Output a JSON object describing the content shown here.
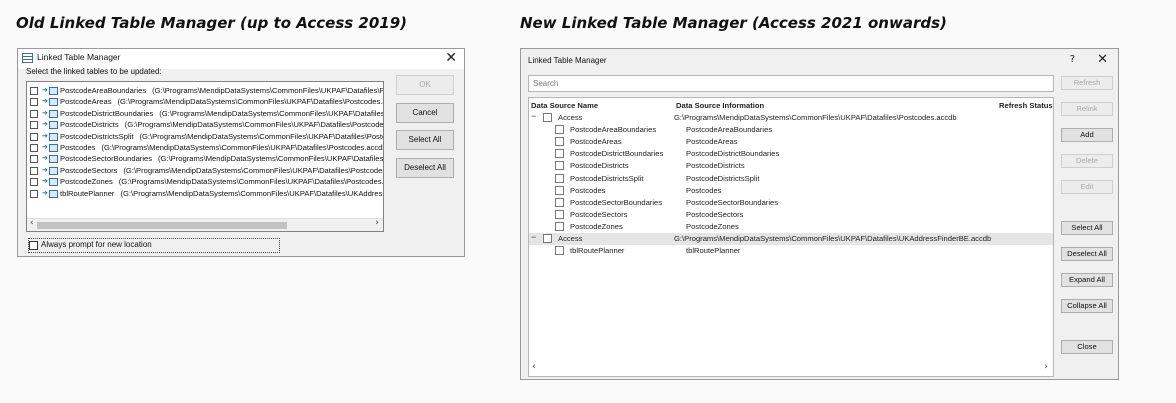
{
  "headings": {
    "old": "Old Linked Table Manager (up to Access 2019)",
    "new": "New Linked Table Manager (Access 2021 onwards)"
  },
  "old_dialog": {
    "title": "Linked Table Manager",
    "close_glyph": "✕",
    "prompt": "Select the linked tables to be updated:",
    "rows": [
      {
        "name": "PostcodeAreaBoundaries",
        "path": "(G:\\Programs\\MendipDataSystems\\CommonFiles\\UKPAF\\Datafiles\\Postcodes.accdb)"
      },
      {
        "name": "PostcodeAreas",
        "path": "(G:\\Programs\\MendipDataSystems\\CommonFiles\\UKPAF\\Datafiles\\Postcodes.accdb)"
      },
      {
        "name": "PostcodeDistrictBoundaries",
        "path": "(G:\\Programs\\MendipDataSystems\\CommonFiles\\UKPAF\\Datafiles\\Postcodes.accdb)"
      },
      {
        "name": "PostcodeDistricts",
        "path": "(G:\\Programs\\MendipDataSystems\\CommonFiles\\UKPAF\\Datafiles\\Postcodes.accdb)"
      },
      {
        "name": "PostcodeDistrictsSplit",
        "path": "(G:\\Programs\\MendipDataSystems\\CommonFiles\\UKPAF\\Datafiles\\Postcodes.accdb)"
      },
      {
        "name": "Postcodes",
        "path": "(G:\\Programs\\MendipDataSystems\\CommonFiles\\UKPAF\\Datafiles\\Postcodes.accdb)"
      },
      {
        "name": "PostcodeSectorBoundaries",
        "path": "(G:\\Programs\\MendipDataSystems\\CommonFiles\\UKPAF\\Datafiles\\Postcodes.accdb)"
      },
      {
        "name": "PostcodeSectors",
        "path": "(G:\\Programs\\MendipDataSystems\\CommonFiles\\UKPAF\\Datafiles\\Postcodes.accdb)"
      },
      {
        "name": "PostcodeZones",
        "path": "(G:\\Programs\\MendipDataSystems\\CommonFiles\\UKPAF\\Datafiles\\Postcodes.accdb)"
      },
      {
        "name": "tblRoutePlanner",
        "path": "(G:\\Programs\\MendipDataSystems\\CommonFiles\\UKPAF\\Datafiles\\UKAddressFinderBE.accdb)"
      }
    ],
    "buttons": {
      "ok": "OK",
      "cancel": "Cancel",
      "select_all": "Select All",
      "deselect_all": "Deselect All"
    },
    "always_prompt": "Always prompt for new location",
    "scroll_left": "‹",
    "scroll_right": "›"
  },
  "new_dialog": {
    "title": "Linked Table Manager",
    "help_glyph": "?",
    "close_glyph": "✕",
    "search_placeholder": "Search",
    "columns": {
      "source_name": "Data Source Name",
      "source_info": "Data Source Information",
      "refresh_status": "Refresh Status"
    },
    "groups": [
      {
        "name": "Access",
        "info": "G:\\Programs\\MendipDataSystems\\CommonFiles\\UKPAF\\Datafiles\\Postcodes.accdb",
        "items": [
          {
            "name": "PostcodeAreaBoundaries",
            "info": "PostcodeAreaBoundaries"
          },
          {
            "name": "PostcodeAreas",
            "info": "PostcodeAreas"
          },
          {
            "name": "PostcodeDistrictBoundaries",
            "info": "PostcodeDistrictBoundaries"
          },
          {
            "name": "PostcodeDistricts",
            "info": "PostcodeDistricts"
          },
          {
            "name": "PostcodeDistrictsSplit",
            "info": "PostcodeDistrictsSplit"
          },
          {
            "name": "Postcodes",
            "info": "Postcodes"
          },
          {
            "name": "PostcodeSectorBoundaries",
            "info": "PostcodeSectorBoundaries"
          },
          {
            "name": "PostcodeSectors",
            "info": "PostcodeSectors"
          },
          {
            "name": "PostcodeZones",
            "info": "PostcodeZones"
          }
        ]
      },
      {
        "name": "Access",
        "info": "G:\\Programs\\MendipDataSystems\\CommonFiles\\UKPAF\\Datafiles\\UKAddressFinderBE.accdb",
        "items": [
          {
            "name": "tblRoutePlanner",
            "info": "tblRoutePlanner"
          }
        ]
      }
    ],
    "buttons": {
      "refresh": "Refresh",
      "relink": "Relink",
      "add": "Add",
      "delete": "Delete",
      "edit": "Edit",
      "select_all": "Select All",
      "deselect_all": "Deselect All",
      "expand_all": "Expand All",
      "collapse_all": "Collapse All",
      "close": "Close"
    },
    "collapse_glyph": "−",
    "scroll_left": "‹",
    "scroll_right": "›"
  }
}
